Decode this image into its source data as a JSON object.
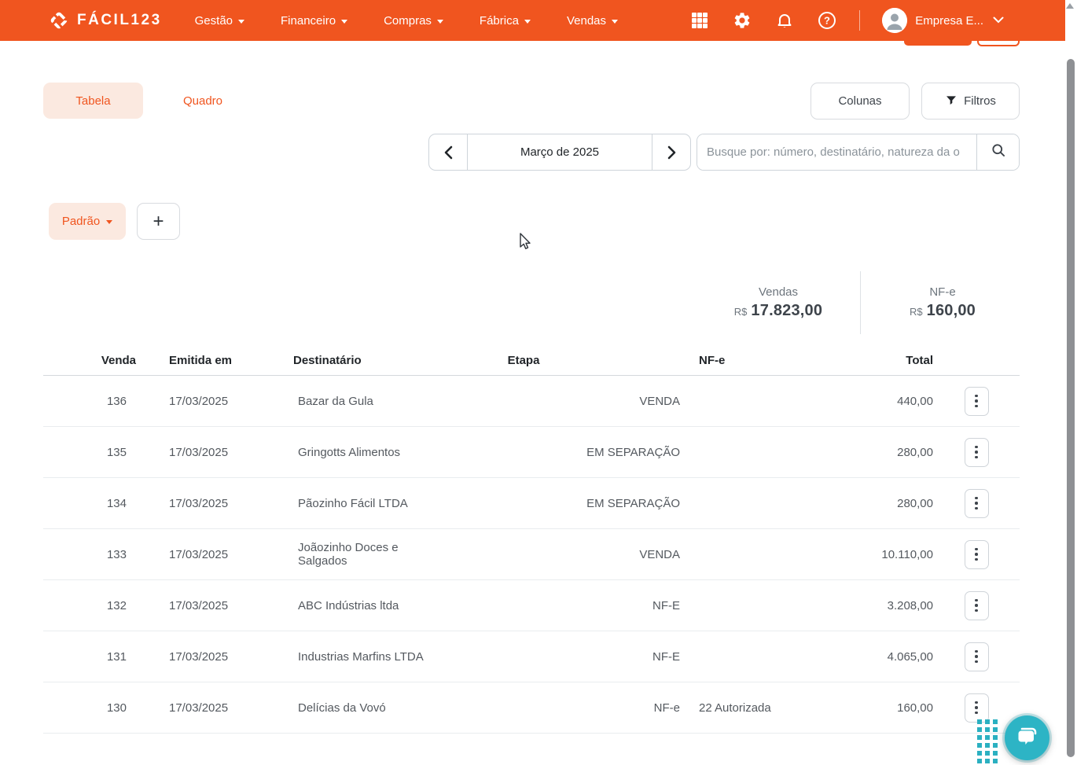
{
  "navbar": {
    "brand": "FÁCIL123",
    "menus": [
      {
        "label": "Gestão"
      },
      {
        "label": "Financeiro"
      },
      {
        "label": "Compras"
      },
      {
        "label": "Fábrica"
      },
      {
        "label": "Vendas"
      }
    ],
    "icons": [
      "apps-grid-icon",
      "settings-gear-icon",
      "notifications-bell-icon",
      "help-circle-icon"
    ],
    "user": "Empresa E...",
    "help_glyph": "?"
  },
  "view_tabs": {
    "tabela": "Tabela",
    "quadro": "Quadro"
  },
  "toolbar": {
    "colunas": "Colunas",
    "filtros": "Filtros"
  },
  "month_nav": {
    "label": "Março de 2025"
  },
  "search": {
    "placeholder": "Busque por: número, destinatário, natureza da o"
  },
  "filter_row": {
    "padrao": "Padrão",
    "add": "+"
  },
  "summary": {
    "vendas_label": "Vendas",
    "vendas_currency": "R$",
    "vendas_value": "17.823,00",
    "nfe_label": "NF-e",
    "nfe_currency": "R$",
    "nfe_value": "160,00"
  },
  "table": {
    "headers": {
      "venda": "Venda",
      "emitida": "Emitida em",
      "destinatario": "Destinatário",
      "etapa": "Etapa",
      "nfe": "NF-e",
      "total": "Total"
    },
    "rows": [
      {
        "venda": "136",
        "emitida": "17/03/2025",
        "destinatario": "Bazar da Gula",
        "etapa": "VENDA",
        "nfe": "",
        "total": "440,00"
      },
      {
        "venda": "135",
        "emitida": "17/03/2025",
        "destinatario": "Gringotts Alimentos",
        "etapa": "EM SEPARAÇÃO",
        "nfe": "",
        "total": "280,00"
      },
      {
        "venda": "134",
        "emitida": "17/03/2025",
        "destinatario": "Pãozinho Fácil LTDA",
        "etapa": "EM SEPARAÇÃO",
        "nfe": "",
        "total": "280,00"
      },
      {
        "venda": "133",
        "emitida": "17/03/2025",
        "destinatario": "Joãozinho Doces e Salgados",
        "etapa": "VENDA",
        "nfe": "",
        "total": "10.110,00"
      },
      {
        "venda": "132",
        "emitida": "17/03/2025",
        "destinatario": "ABC Indústrias ltda",
        "etapa": "NF-E",
        "nfe": "",
        "total": "3.208,00"
      },
      {
        "venda": "131",
        "emitida": "17/03/2025",
        "destinatario": "Industrias Marfins LTDA",
        "etapa": "NF-E",
        "nfe": "",
        "total": "4.065,00"
      },
      {
        "venda": "130",
        "emitida": "17/03/2025",
        "destinatario": "Delícias da Vovó",
        "etapa": "NF-e",
        "nfe": "22 Autorizada",
        "total": "160,00"
      }
    ]
  },
  "colors": {
    "brand_orange": "#f0551f",
    "peach_bg": "#fbe9e0",
    "teal_chat": "#2db4c5",
    "text_dark": "#3e444b",
    "text_gray": "#6d757d",
    "border_gray": "#ced4da"
  }
}
